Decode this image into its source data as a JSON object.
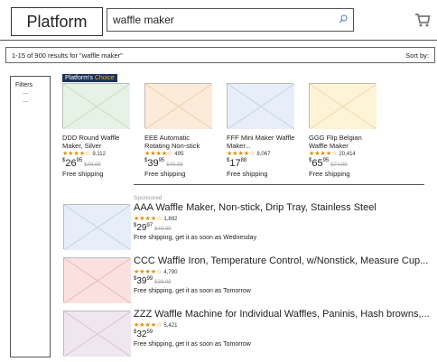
{
  "header": {
    "logo": "Platform",
    "search_value": "waffle maker"
  },
  "results": {
    "summary": "1-15 of 900 results for \"waffle maker\"",
    "sort_label": "Sort by:"
  },
  "filters": {
    "title": "Filters",
    "items": [
      "...",
      "..."
    ]
  },
  "choice": {
    "badge_prefix": "Platform's",
    "badge_suffix": "Choice",
    "products": [
      {
        "title": "DDD Round Waffle Maker, Silver",
        "stars": "★★★★☆",
        "reviews": "9,112",
        "price_whole": "26",
        "price_cents": "95",
        "old_price": "$49.99",
        "shipping": "Free shipping",
        "thumb_color": "#e6f2e6",
        "thumb_line": "#c6dcc6"
      },
      {
        "title": "EEE Automatic Rotating Non-stick",
        "stars": "★★★★☆",
        "reviews": "495",
        "price_whole": "39",
        "price_cents": "95",
        "old_price": "$49.99",
        "shipping": "Free shipping",
        "thumb_color": "#fcebd8",
        "thumb_line": "#ecd0b0"
      },
      {
        "title": "FFF Mini Maker Waffle Maker...",
        "stars": "★★★★☆",
        "reviews": "8,067",
        "price_whole": "17",
        "price_cents": "88",
        "old_price": "",
        "shipping": "Free shipping",
        "thumb_color": "#e8eef8",
        "thumb_line": "#c8d2e6"
      },
      {
        "title": "GGG Flip Belgian Waffle Maker",
        "stars": "★★★★☆",
        "reviews": "20,414",
        "price_whole": "65",
        "price_cents": "95",
        "old_price": "$74.99",
        "shipping": "Free shipping",
        "thumb_color": "#fdf3d6",
        "thumb_line": "#ecdcaa"
      }
    ]
  },
  "list": {
    "sponsored_label": "Sponsored",
    "products": [
      {
        "title": "AAA Waffle Maker, Non-stick, Drip Tray, Stainless Steel",
        "stars": "★★★★☆",
        "reviews": "1,892",
        "price_whole": "29",
        "price_cents": "97",
        "old_price": "$49.99",
        "shipping": "Free shipping, get it as soon as Wednesday",
        "thumb_color": "#e8eef8",
        "thumb_line": "#c8d2e6"
      },
      {
        "title": "CCC Waffle Iron, Temperature Control, w/Nonstick, Measure Cup...",
        "stars": "★★★★☆",
        "reviews": "4,790",
        "price_whole": "39",
        "price_cents": "99",
        "old_price": "$39.99",
        "shipping": "Free shipping, get it as soon as Tomorrow",
        "thumb_color": "#fbe0e0",
        "thumb_line": "#e8bcbc"
      },
      {
        "title": "ZZZ Waffle Machine for Individual Waffles, Paninis, Hash browns,...",
        "stars": "★★★★☆",
        "reviews": "5,421",
        "price_whole": "32",
        "price_cents": "59",
        "old_price": "",
        "shipping": "Free shipping, get it as soon as Tomorrow",
        "thumb_color": "#efe6f0",
        "thumb_line": "#d6c6d8"
      }
    ]
  },
  "icons": {
    "search": "search-icon",
    "cart": "cart-icon"
  }
}
